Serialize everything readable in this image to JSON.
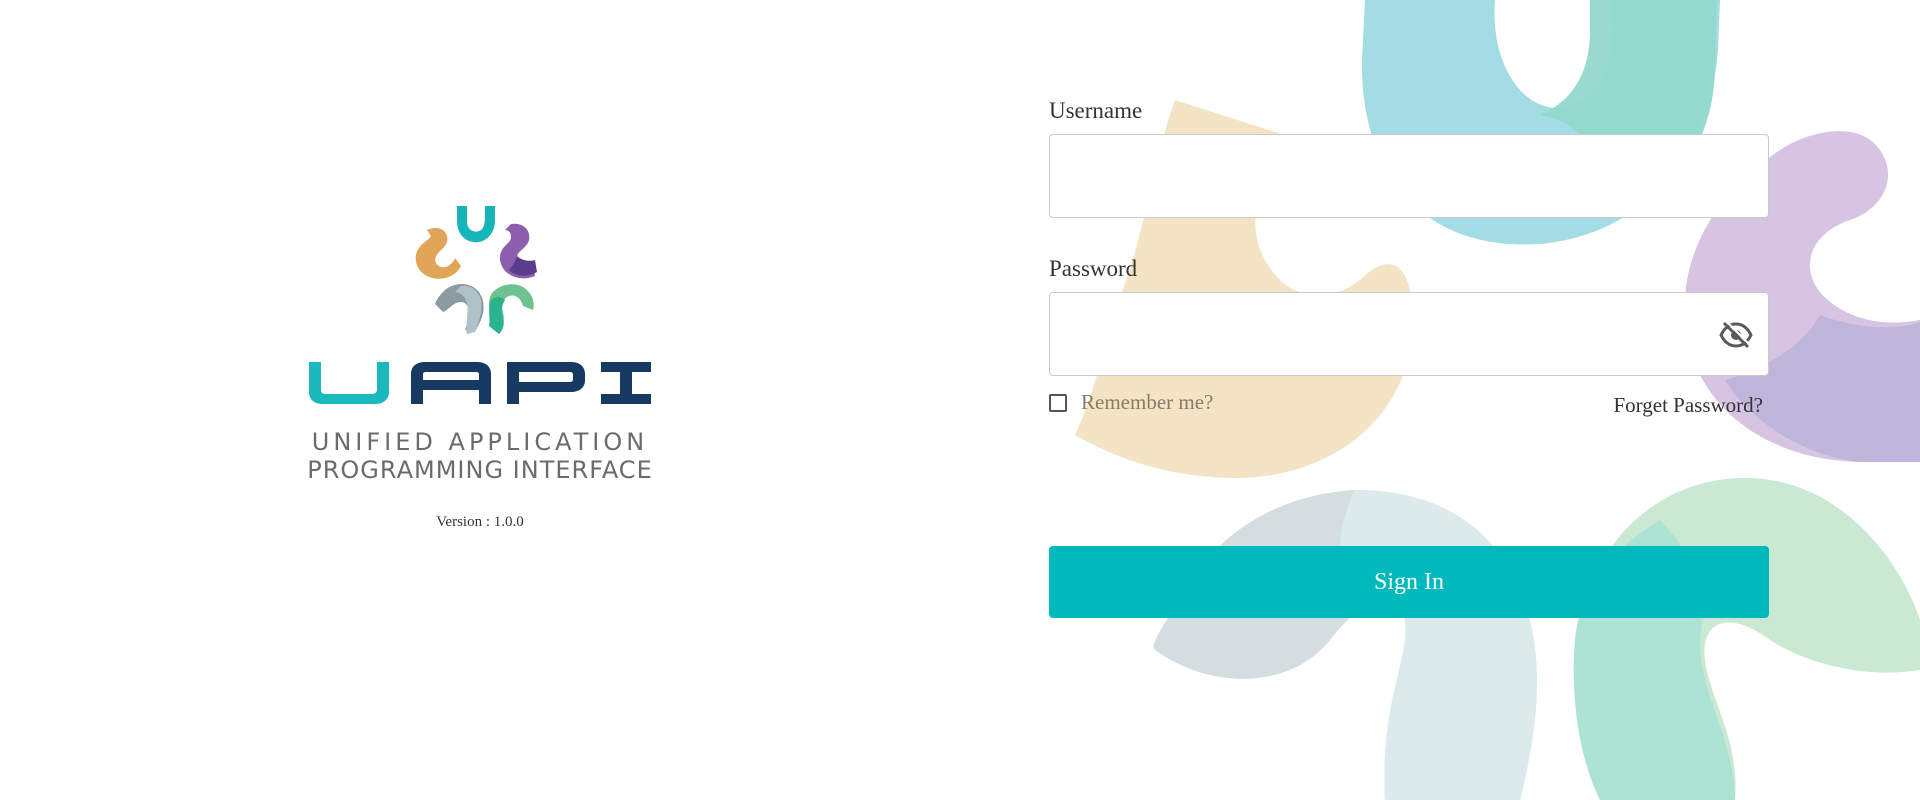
{
  "brand": {
    "wordmark": "UAPI",
    "tagline_line1": "UNIFIED APPLICATION",
    "tagline_line2": "PROGRAMMING INTERFACE",
    "version": "Version : 1.0.0",
    "logo_icon": "flower-logo-icon"
  },
  "form": {
    "username_label": "Username",
    "username_value": "",
    "password_label": "Password",
    "password_value": "",
    "password_toggle_icon": "eye-slash-icon",
    "remember_label": "Remember me?",
    "remember_checked": false,
    "forgot_label": "Forget Password?",
    "signin_label": "Sign In"
  },
  "colors": {
    "accent": "#00b9bd",
    "wordmark_navy": "#173a63",
    "wordmark_teal": "#1bb8be",
    "tagline_gray": "#6b6b6b",
    "petal_teal": "#a4dce4",
    "petal_mint": "#92d8cc",
    "petal_purple": "#d7c4e2",
    "petal_sand": "#f2e1bf",
    "petal_green": "#c9e9d2",
    "petal_gray": "#cfd9dc"
  }
}
